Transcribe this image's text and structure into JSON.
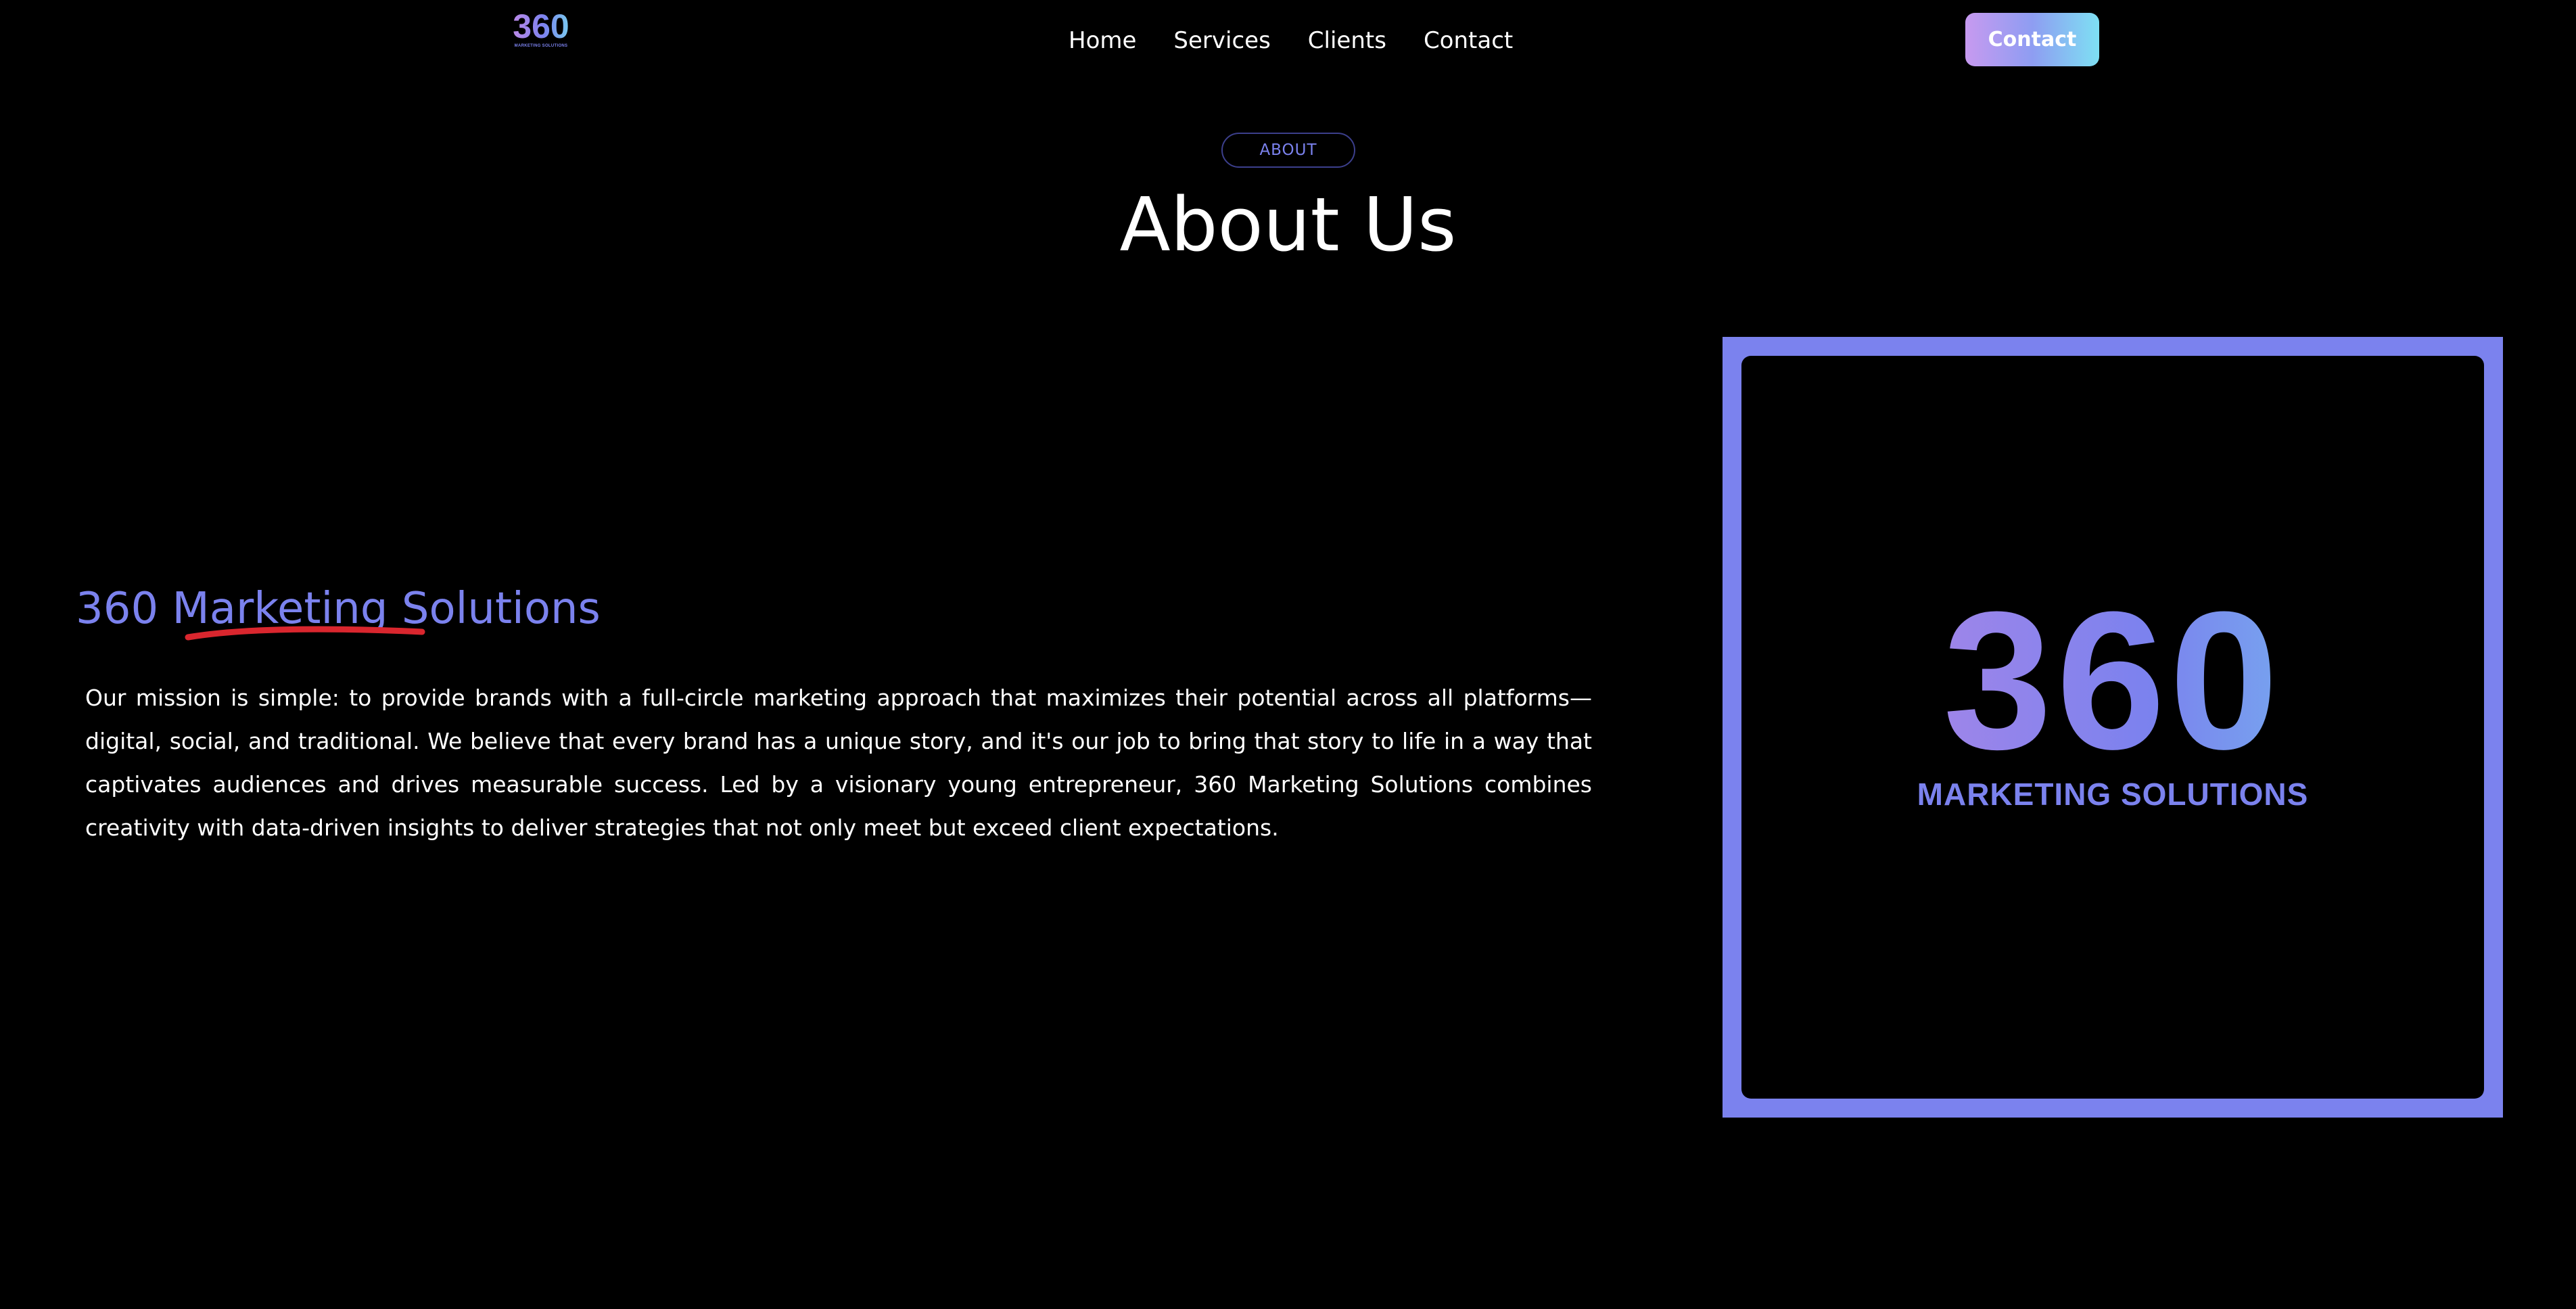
{
  "nav": {
    "logo_number": "360",
    "logo_subtitle": "MARKETING SOLUTIONS",
    "links": [
      {
        "label": "Home"
      },
      {
        "label": "Services"
      },
      {
        "label": "Clients"
      },
      {
        "label": "Contact"
      }
    ],
    "contact_button": "Contact"
  },
  "section": {
    "badge": "ABOUT",
    "title": "About Us"
  },
  "about": {
    "company_name": "360 Marketing Solutions",
    "mission": "Our mission is simple: to provide brands with a full-circle marketing approach that maximizes their potential across all platforms—digital, social, and traditional. We believe that every brand has a unique story, and it's our job to bring that story to life in a way that captivates audiences and drives measurable success. Led by a visionary young entrepreneur, 360 Marketing Solutions combines creativity with data-driven insights to deliver strategies that not only meet but exceed client expectations."
  },
  "image": {
    "number": "360",
    "subtitle": "MARKETING SOLUTIONS"
  },
  "colors": {
    "accent": "#7b82ee",
    "gradient_start": "#c98ae6",
    "gradient_end": "#7fe2f2",
    "underline": "#d9262e",
    "background": "#000000"
  }
}
